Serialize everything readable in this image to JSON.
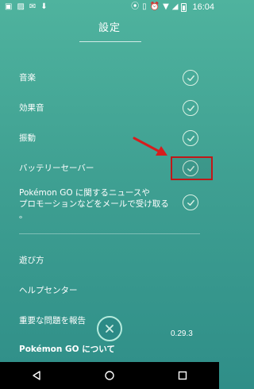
{
  "status_bar": {
    "time": "16:04",
    "left_icons": [
      "sim-icon",
      "image-icon",
      "mail-icon",
      "download-icon"
    ],
    "right_icons": [
      "location-icon",
      "vibrate-icon",
      "alarm-icon",
      "wifi-icon",
      "signal-icon",
      "battery-icon"
    ]
  },
  "header": {
    "title": "設定"
  },
  "settings": [
    {
      "label": "音楽",
      "enabled": true
    },
    {
      "label": "効果音",
      "enabled": true
    },
    {
      "label": "振動",
      "enabled": true
    },
    {
      "label": "バッテリーセーバー",
      "enabled": true
    },
    {
      "label_line1": "Pokémon GO に関するニュースや",
      "label_line2": "プロモーションなどをメールで受け取る",
      "label_line3": "。",
      "enabled": true
    }
  ],
  "links": [
    {
      "label": "遊び方"
    },
    {
      "label": "ヘルプセンター"
    },
    {
      "label": "重要な問題を報告"
    },
    {
      "label": "Pokémon GO について"
    }
  ],
  "version": "0.29.3",
  "annotation": {
    "arrow_color": "#d61d1d",
    "box_color": "#c01818"
  },
  "colors": {
    "bg_top": "#4fb39e",
    "bg_bottom": "#2f8e88",
    "check_stroke": "#d8f1e4"
  },
  "nav": [
    "back-icon",
    "home-icon",
    "recents-icon"
  ]
}
